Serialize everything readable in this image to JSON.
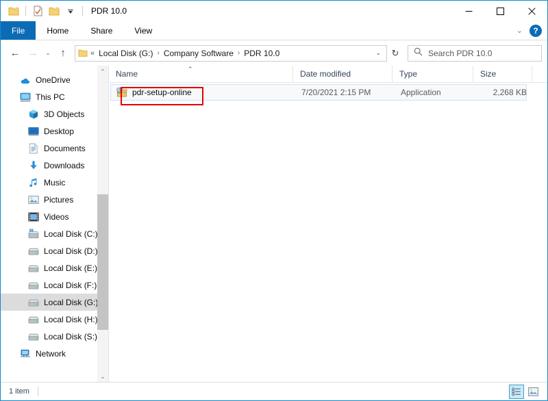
{
  "window": {
    "title": "PDR 10.0",
    "quick_access": [
      {
        "name": "new-folder-icon",
        "label": "New folder"
      },
      {
        "name": "properties-icon",
        "label": "Properties"
      },
      {
        "name": "folder-icon",
        "label": "Folder"
      },
      {
        "name": "customize-qat-chevron-icon",
        "label": "Customize Quick Access Toolbar"
      }
    ],
    "controls": {
      "minimize": "—",
      "maximize": "☐",
      "close": "✕"
    }
  },
  "ribbon": {
    "tabs": [
      {
        "label": "File",
        "active": true
      },
      {
        "label": "Home",
        "active": false
      },
      {
        "label": "Share",
        "active": false
      },
      {
        "label": "View",
        "active": false
      }
    ],
    "collapse_chevron": "⌄",
    "help_label": "?"
  },
  "navigation": {
    "back": "←",
    "forward": "→",
    "recent": "⌄",
    "up": "↑",
    "refresh": "↻",
    "address_overflow": "«",
    "breadcrumbs": [
      "Local Disk (G:)",
      "Company Software",
      "PDR 10.0"
    ],
    "breadcrumb_separator": "›",
    "address_dropdown": "⌄"
  },
  "search": {
    "placeholder": "Search PDR 10.0",
    "value": "",
    "icon": "search-icon"
  },
  "sidebar": {
    "items": [
      {
        "label": "OneDrive",
        "icon": "onedrive-cloud-icon",
        "indent": false,
        "selected": false
      },
      {
        "label": "This PC",
        "icon": "this-pc-monitor-icon",
        "indent": false,
        "selected": false
      },
      {
        "label": "3D Objects",
        "icon": "3d-objects-icon",
        "indent": true,
        "selected": false
      },
      {
        "label": "Desktop",
        "icon": "desktop-icon",
        "indent": true,
        "selected": false
      },
      {
        "label": "Documents",
        "icon": "documents-icon",
        "indent": true,
        "selected": false
      },
      {
        "label": "Downloads",
        "icon": "downloads-arrow-icon",
        "indent": true,
        "selected": false
      },
      {
        "label": "Music",
        "icon": "music-note-icon",
        "indent": true,
        "selected": false
      },
      {
        "label": "Pictures",
        "icon": "pictures-icon",
        "indent": true,
        "selected": false
      },
      {
        "label": "Videos",
        "icon": "videos-icon",
        "indent": true,
        "selected": false
      },
      {
        "label": "Local Disk (C:)",
        "icon": "system-drive-icon",
        "indent": true,
        "selected": false
      },
      {
        "label": "Local Disk (D:)",
        "icon": "drive-icon",
        "indent": true,
        "selected": false
      },
      {
        "label": "Local Disk (E:)",
        "icon": "drive-icon",
        "indent": true,
        "selected": false
      },
      {
        "label": "Local Disk (F:)",
        "icon": "drive-icon",
        "indent": true,
        "selected": false
      },
      {
        "label": "Local Disk (G:)",
        "icon": "drive-icon",
        "indent": true,
        "selected": true
      },
      {
        "label": "Local Disk (H:)",
        "icon": "drive-icon",
        "indent": true,
        "selected": false
      },
      {
        "label": "Local Disk (S:)",
        "icon": "drive-icon",
        "indent": true,
        "selected": false
      },
      {
        "label": "Network",
        "icon": "network-icon",
        "indent": false,
        "selected": false
      }
    ],
    "scroll_up": "⌃",
    "scroll_down": "⌄"
  },
  "filelist": {
    "columns": [
      {
        "label": "Name",
        "key": "name"
      },
      {
        "label": "Date modified",
        "key": "date"
      },
      {
        "label": "Type",
        "key": "type"
      },
      {
        "label": "Size",
        "key": "size"
      }
    ],
    "sort_column": "Name",
    "sort_direction": "ascending",
    "sort_caret": "⌃",
    "rows": [
      {
        "name": "pdr-setup-online",
        "date": "7/20/2021 2:15 PM",
        "type": "Application",
        "size": "2,268 KB",
        "icon": "installer-shield-icon",
        "selected": true,
        "annotated": true
      }
    ]
  },
  "statusbar": {
    "item_count": "1 item",
    "views": [
      {
        "name": "details-view-button",
        "active": true
      },
      {
        "name": "large-icons-view-button",
        "active": false
      }
    ]
  },
  "colors": {
    "accent": "#0b6cb5",
    "window_border": "#0e8ccb",
    "annotation": "#e60000",
    "selection": "#f7f9fb",
    "selection_border": "#cce3f5",
    "sidebar_selected": "#dcdcdc"
  }
}
